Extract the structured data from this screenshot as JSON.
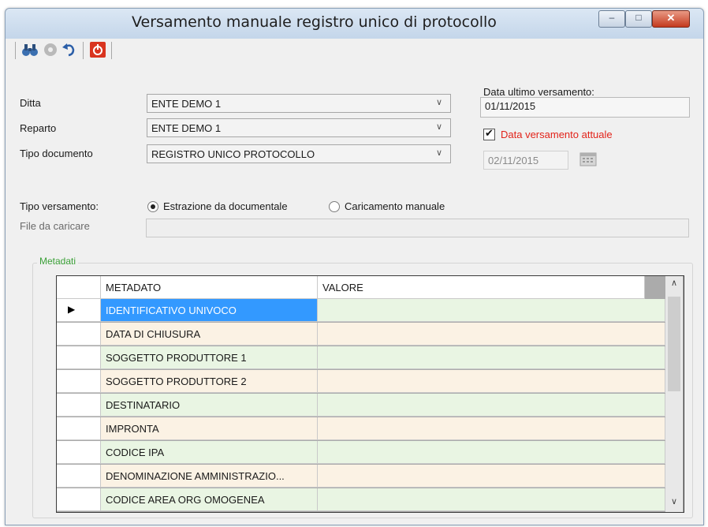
{
  "window": {
    "title": "Versamento manuale registro unico di protocollo",
    "controls": {
      "minimize": "–",
      "maximize": "□",
      "close": "✕"
    }
  },
  "toolbar": {
    "icons": [
      "binoculars-icon",
      "disc-icon",
      "undo-icon",
      "power-icon"
    ]
  },
  "form": {
    "ditta_label": "Ditta",
    "ditta_value": "ENTE DEMO 1",
    "reparto_label": "Reparto",
    "reparto_value": "ENTE DEMO 1",
    "tipo_documento_label": "Tipo documento",
    "tipo_documento_value": "REGISTRO UNICO PROTOCOLLO",
    "data_ultimo_label": "Data ultimo versamento:",
    "data_ultimo_value": "01/11/2015",
    "data_attuale_label": "Data versamento attuale",
    "data_attuale_checked": true,
    "data_attuale_value": "02/11/2015",
    "tipo_versamento_label": "Tipo versamento:",
    "option_estrazione": "Estrazione da documentale",
    "option_caricamento": "Caricamento manuale",
    "selected_option": "Estrazione da documentale",
    "file_label": "File da caricare",
    "file_value": ""
  },
  "metadati": {
    "legend": "Metadati",
    "columns": [
      "METADATO",
      "VALORE"
    ],
    "current_row": 0,
    "rows": [
      {
        "metadato": "IDENTIFICATIVO UNIVOCO",
        "valore": ""
      },
      {
        "metadato": "DATA DI CHIUSURA",
        "valore": ""
      },
      {
        "metadato": "SOGGETTO PRODUTTORE 1",
        "valore": ""
      },
      {
        "metadato": "SOGGETTO PRODUTTORE 2",
        "valore": ""
      },
      {
        "metadato": "DESTINATARIO",
        "valore": ""
      },
      {
        "metadato": "IMPRONTA",
        "valore": ""
      },
      {
        "metadato": "CODICE IPA",
        "valore": ""
      },
      {
        "metadato": "DENOMINAZIONE AMMINISTRAZIO...",
        "valore": ""
      },
      {
        "metadato": "CODICE AREA ORG OMOGENEA",
        "valore": ""
      }
    ]
  },
  "colors": {
    "row_even": "#e9f5e3",
    "row_odd": "#fbf2e4",
    "selected_bg": "#3399ff",
    "selected_fg": "#ffffff",
    "red_label": "#e2231a",
    "legend_green": "#3aa037"
  }
}
